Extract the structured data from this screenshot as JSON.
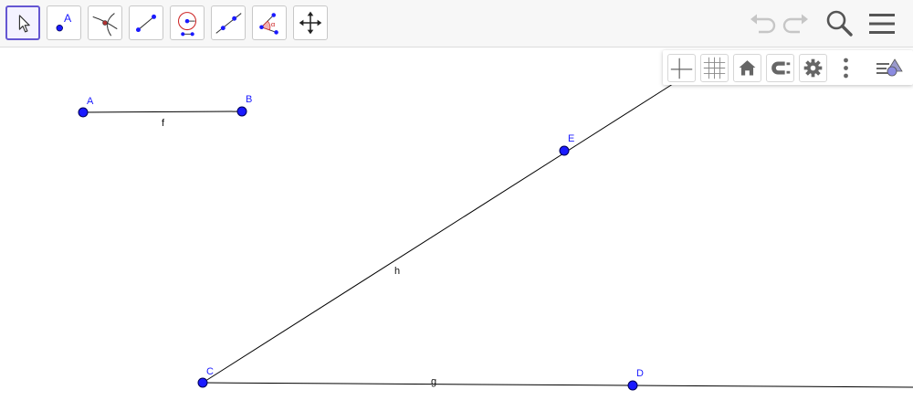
{
  "toolbar": {
    "tools": [
      {
        "name": "move-tool",
        "selected": true
      },
      {
        "name": "point-tool",
        "selected": false,
        "label": "A"
      },
      {
        "name": "intersect-tool",
        "selected": false
      },
      {
        "name": "segment-tool",
        "selected": false
      },
      {
        "name": "compass-tool",
        "selected": false
      },
      {
        "name": "line-tool",
        "selected": false
      },
      {
        "name": "angle-tool",
        "selected": false,
        "label": "α"
      },
      {
        "name": "move-graphics-view-tool",
        "selected": false
      }
    ],
    "right_icons": [
      "undo-icon",
      "redo-icon",
      "search-icon",
      "menu-icon"
    ]
  },
  "stylebar": {
    "icons": [
      "axes-icon",
      "grid-icon",
      "home-icon",
      "point-capturing-icon",
      "gear-icon",
      "more-vertical-icon",
      "style-toggle-icon"
    ]
  },
  "colors": {
    "point_fill": "#1a1aff",
    "point_stroke": "#000055",
    "label_point": "#1a1aff",
    "line": "#000000",
    "selected_tool": "#6557d2"
  },
  "geometry": {
    "points": [
      {
        "name": "A",
        "label": "A"
      },
      {
        "name": "B",
        "label": "B"
      },
      {
        "name": "C",
        "label": "C"
      },
      {
        "name": "D",
        "label": "D"
      },
      {
        "name": "E",
        "label": "E"
      }
    ],
    "lines": [
      {
        "name": "f",
        "label": "f",
        "type": "segment",
        "from": "A",
        "to": "B"
      },
      {
        "name": "g",
        "label": "g",
        "type": "ray",
        "from": "C",
        "through": "D"
      },
      {
        "name": "h",
        "label": "h",
        "type": "ray",
        "from": "C",
        "through": "E"
      }
    ]
  }
}
